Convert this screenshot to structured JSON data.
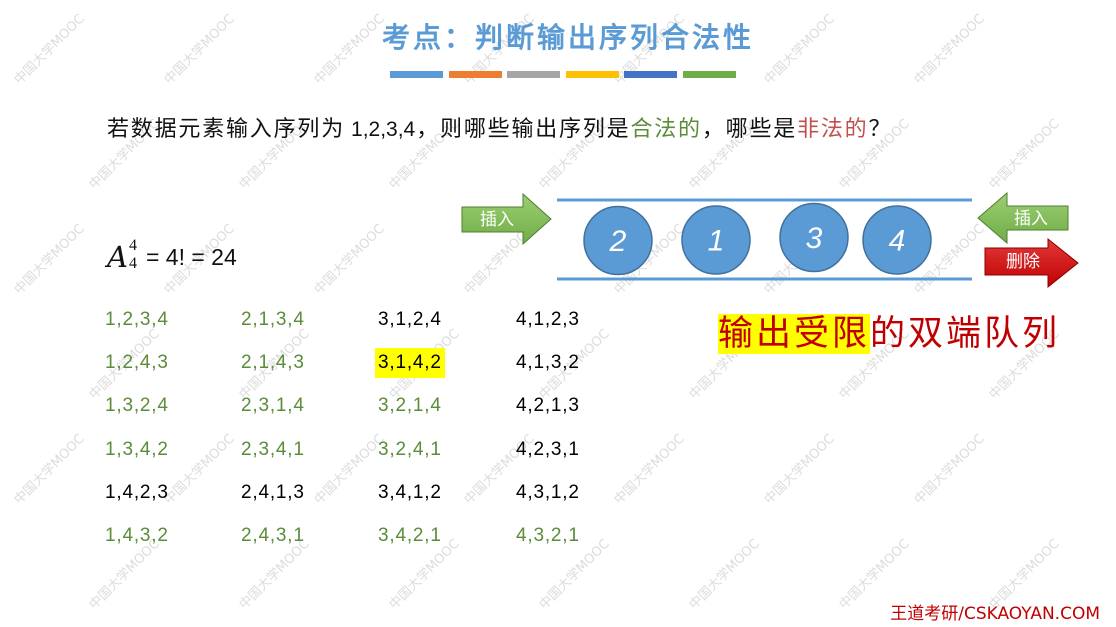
{
  "slide": {
    "title": "考点：判断输出序列合法性",
    "title_bar": [
      "#5b9bd5",
      "#ed7d31",
      "#a5a5a5",
      "#ffc000",
      "#4472c4",
      "#70ad47"
    ],
    "question": {
      "prefix": "若数据元素输入序列为",
      "input_sequence": "1,2,3,4",
      "middle": "，则哪些输出序列是",
      "legal": "合法的",
      "connector": "，哪些是",
      "illegal": "非法的",
      "suffix": "？"
    },
    "formula": {
      "symbol": "A",
      "superscript": "4",
      "subscript": "4",
      "equation": "= 4! = 24"
    },
    "sequences": [
      [
        {
          "text": "1,2,3,4",
          "color": "#5b8c39"
        },
        {
          "text": "1,2,4,3",
          "color": "#5b8c39"
        },
        {
          "text": "1,3,2,4",
          "color": "#5b8c39"
        },
        {
          "text": "1,3,4,2",
          "color": "#5b8c39"
        },
        {
          "text": "1,4,2,3",
          "color": "#000000"
        },
        {
          "text": "1,4,3,2",
          "color": "#5b8c39"
        }
      ],
      [
        {
          "text": "2,1,3,4",
          "color": "#5b8c39"
        },
        {
          "text": "2,1,4,3",
          "color": "#5b8c39"
        },
        {
          "text": "2,3,1,4",
          "color": "#5b8c39"
        },
        {
          "text": "2,3,4,1",
          "color": "#5b8c39"
        },
        {
          "text": "2,4,1,3",
          "color": "#000000"
        },
        {
          "text": "2,4,3,1",
          "color": "#5b8c39"
        }
      ],
      [
        {
          "text": "3,1,2,4",
          "color": "#000000"
        },
        {
          "text": "3,1,4,2",
          "color": "#000000",
          "highlight": true
        },
        {
          "text": "3,2,1,4",
          "color": "#5b8c39"
        },
        {
          "text": "3,2,4,1",
          "color": "#5b8c39"
        },
        {
          "text": "3,4,1,2",
          "color": "#000000"
        },
        {
          "text": "3,4,2,1",
          "color": "#5b8c39"
        }
      ],
      [
        {
          "text": "4,1,2,3",
          "color": "#000000"
        },
        {
          "text": "4,1,3,2",
          "color": "#000000"
        },
        {
          "text": "4,2,1,3",
          "color": "#000000"
        },
        {
          "text": "4,2,3,1",
          "color": "#000000"
        },
        {
          "text": "4,3,1,2",
          "color": "#000000"
        },
        {
          "text": "4,3,2,1",
          "color": "#5b8c39"
        }
      ]
    ],
    "deque": {
      "elements": [
        "2",
        "1",
        "3",
        "4"
      ],
      "left_insert_label": "插入",
      "right_insert_label": "插入",
      "right_delete_label": "删除"
    },
    "caption": {
      "highlighted": "输出受限",
      "rest": "的双端队列"
    },
    "footer": "王道考研/CSKAOYAN.COM",
    "watermark": "中国大学MOOC"
  },
  "colors": {
    "title": "#5b9bd5",
    "default_text": "#000000",
    "legal": "#5b8c39",
    "illegal": "#c0504d",
    "highlight": "#ffff00",
    "deque_line": "#5b9bd5",
    "node_fill": "#5b9bd5",
    "node_stroke": "#41719c",
    "node_text": "#ffffff",
    "insert_arrow": "#70ad47",
    "delete_arrow": "#c00000",
    "caption": "#c00000",
    "footer": "#c00000",
    "watermark": "#dcdcdc"
  }
}
